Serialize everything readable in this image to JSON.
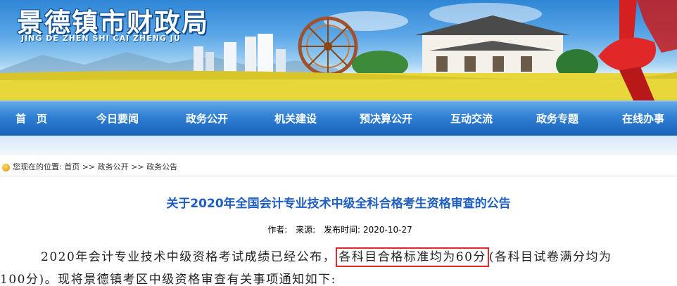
{
  "header": {
    "title": "景德镇市财政局",
    "pinyin": "JING DE ZHEN SHI CAI ZHENG JU"
  },
  "nav": {
    "items": [
      "首　页",
      "今日要闻",
      "政务公开",
      "机关建设",
      "预决算公开",
      "互动交流",
      "政务专题",
      "在线办事"
    ]
  },
  "breadcrumb": {
    "prefix": "您现在的位置:",
    "items": [
      "首页",
      "政务公开",
      "政务公告"
    ],
    "separator": ">>"
  },
  "article": {
    "title": "关于2020年全国会计专业技术中级全科合格考生资格审查的公告",
    "author_label": "作者:",
    "source_label": "来源:",
    "date_label": "发布时间:",
    "date": "2020-10-27",
    "para1_before": "2020年会计专业技术中级资格考试成绩已经公布，",
    "para1_highlight": "各科目合格标准均为60分",
    "para1_after": "(各科目试卷满分均为",
    "para2": "100分)。现将景德镇考区中级资格审查有关事项通知如下:"
  },
  "colors": {
    "nav_bg": "#2f7fd3",
    "title_blue": "#1d5ec4",
    "highlight_border": "#e0292b"
  }
}
